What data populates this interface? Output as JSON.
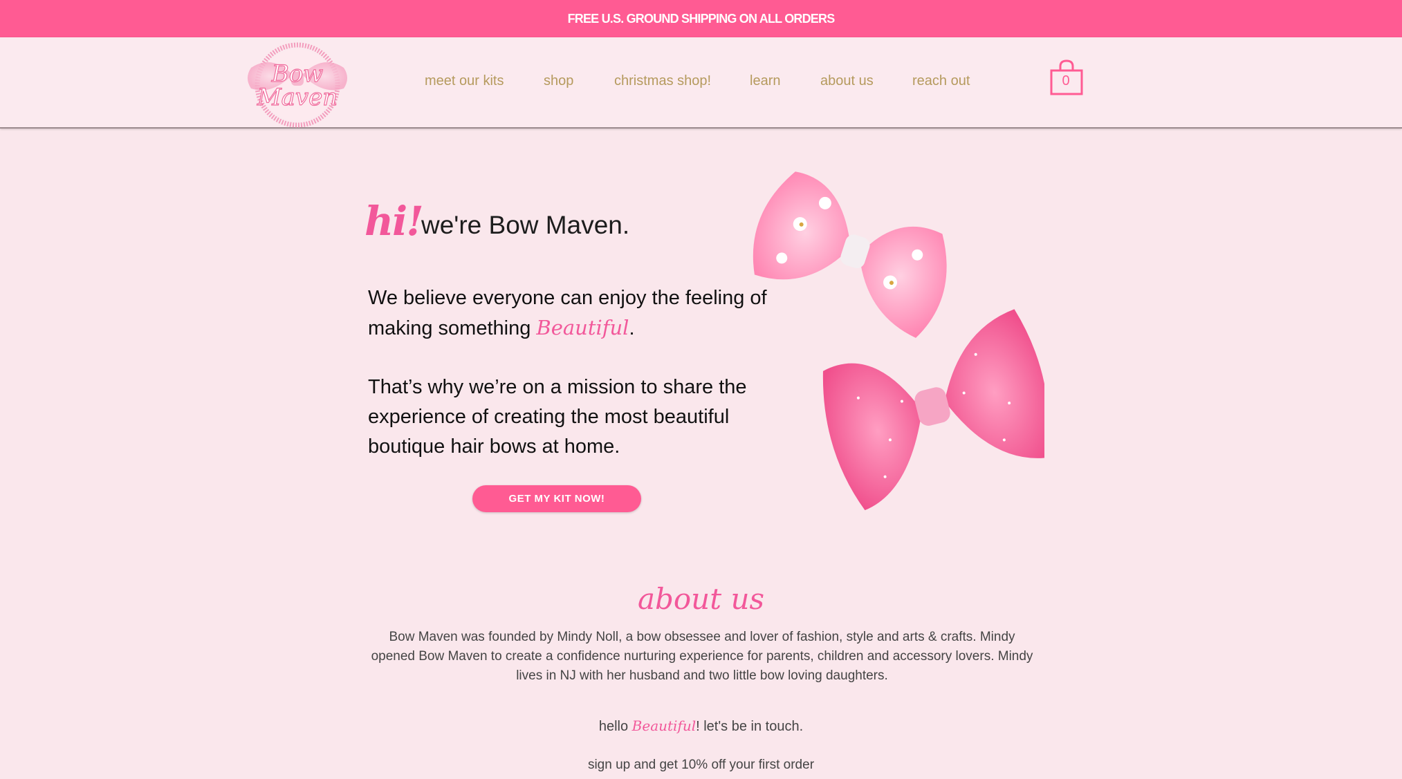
{
  "promo": {
    "text": "FREE U.S. GROUND SHIPPING ON ALL ORDERS"
  },
  "brand": {
    "logo_line1": "Bow",
    "logo_line2": "Maven"
  },
  "nav": {
    "items": [
      "meet our kits",
      "shop",
      "christmas shop!",
      "learn",
      "about us",
      "reach out"
    ]
  },
  "cart": {
    "count": "0"
  },
  "hero": {
    "hi": "hi!",
    "title": "we're Bow Maven.",
    "p1_before": "We believe everyone can enjoy the feeling of making something ",
    "p1_script": "Beautiful",
    "p1_after": ".",
    "p2": "That’s why we’re on a mission to share the experience of creating the most beautiful boutique hair bows at home.",
    "cta": "GET MY KIT NOW!"
  },
  "about": {
    "heading": "about us",
    "text": "Bow Maven was founded by Mindy Noll, a bow obsessee and lover of fashion, style and arts & crafts. Mindy opened Bow Maven to create a confidence nurturing experience for parents, children and accessory lovers. Mindy lives in NJ with her husband and two little bow loving daughters."
  },
  "newsletter": {
    "hello_before": "hello ",
    "hello_script": "Beautiful",
    "hello_after": "! let's be in touch.",
    "signup": "sign up and get 10% off your first order"
  },
  "colors": {
    "accent": "#ff5b93",
    "nav_text": "#b59a5d",
    "background": "#fae7ec"
  }
}
